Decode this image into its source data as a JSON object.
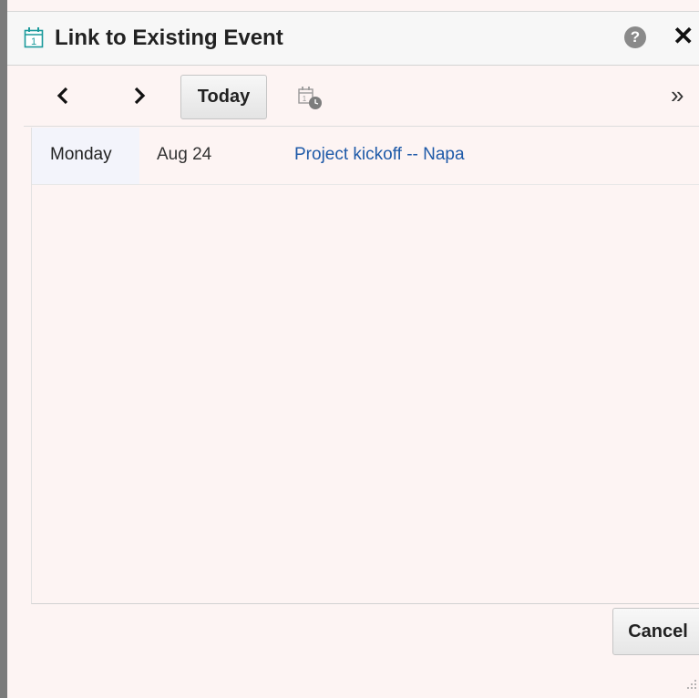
{
  "dialog": {
    "title": "Link to Existing Event",
    "help_icon": "help-icon",
    "help_label": "?",
    "close_icon": "close-icon",
    "close_label": "✕"
  },
  "toolbar": {
    "prev_icon": "chevron-left-icon",
    "next_icon": "chevron-right-icon",
    "today_label": "Today",
    "calendar_icon": "calendar-clock-icon",
    "more_icon": "double-chevron-right-icon",
    "more_label": "»"
  },
  "events": [
    {
      "day": "Monday",
      "date": "Aug 24",
      "title": "Project kickoff -- Napa"
    }
  ],
  "footer": {
    "cancel_label": "Cancel"
  },
  "colors": {
    "accent_teal": "#1b9a9b",
    "link_blue": "#1e5aa8",
    "dialog_bg": "#fdf4f3"
  }
}
